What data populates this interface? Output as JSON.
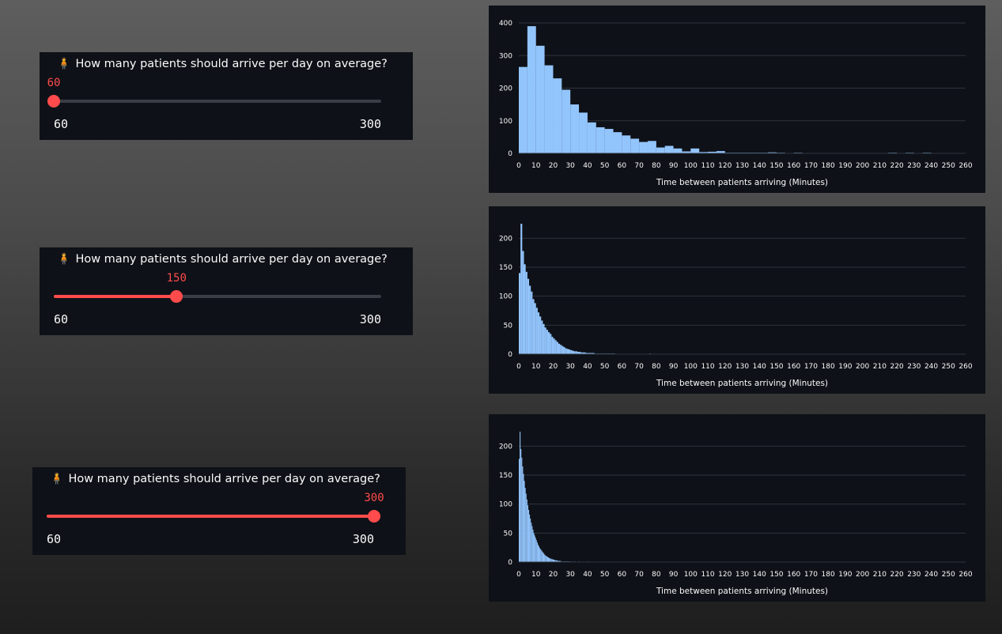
{
  "sliders": [
    {
      "label": "How many patients should arrive per day on average?",
      "icon": "person-standing-icon",
      "value": "60",
      "min": "60",
      "max": "300",
      "fraction": 0.0
    },
    {
      "label": "How many patients should arrive per day on average?",
      "icon": "person-standing-icon",
      "value": "150",
      "min": "60",
      "max": "300",
      "fraction": 0.375
    },
    {
      "label": "How many patients should arrive per day on average?",
      "icon": "person-standing-icon",
      "value": "300",
      "min": "60",
      "max": "300",
      "fraction": 1.0
    }
  ],
  "colors": {
    "accent": "#ff4b4b",
    "bar": "#93c5fd",
    "panel_bg": "#0e1117",
    "grid": "#2e323c",
    "text": "#fafafa"
  },
  "chart_data": [
    {
      "type": "bar",
      "title": "",
      "xlabel": "Time between patients arriving (Minutes)",
      "ylabel": "",
      "xlim": [
        0,
        260
      ],
      "ylim": [
        0,
        400
      ],
      "xticks": [
        0,
        10,
        20,
        30,
        40,
        50,
        60,
        70,
        80,
        90,
        100,
        110,
        120,
        130,
        140,
        150,
        160,
        170,
        180,
        190,
        200,
        210,
        220,
        230,
        240,
        250,
        260
      ],
      "yticks": [
        0,
        100,
        200,
        300,
        400
      ],
      "bin_width": 5,
      "values": [
        265,
        390,
        330,
        270,
        230,
        195,
        150,
        125,
        95,
        80,
        75,
        65,
        55,
        45,
        35,
        38,
        18,
        23,
        15,
        6,
        15,
        4,
        5,
        7,
        2,
        2,
        2,
        2,
        2,
        3,
        2,
        0,
        2,
        0,
        0,
        0,
        0,
        0,
        0,
        0,
        0,
        0,
        0,
        2,
        0,
        2,
        0,
        2,
        0,
        0,
        0,
        0,
        0
      ]
    },
    {
      "type": "bar",
      "title": "",
      "xlabel": "Time between patients arriving (Minutes)",
      "ylabel": "",
      "xlim": [
        0,
        260
      ],
      "ylim": [
        0,
        225
      ],
      "xticks": [
        0,
        10,
        20,
        30,
        40,
        50,
        60,
        70,
        80,
        90,
        100,
        110,
        120,
        130,
        140,
        150,
        160,
        170,
        180,
        190,
        200,
        210,
        220,
        230,
        240,
        250,
        260
      ],
      "yticks": [
        0,
        50,
        100,
        150,
        200
      ],
      "bin_width": 1,
      "values": [
        140,
        225,
        178,
        155,
        142,
        130,
        118,
        108,
        95,
        88,
        80,
        72,
        65,
        58,
        52,
        46,
        42,
        38,
        35,
        30,
        27,
        24,
        21,
        18,
        16,
        14,
        12,
        10,
        9,
        8,
        7,
        6,
        5,
        5,
        4,
        4,
        3,
        3,
        3,
        2,
        2,
        2,
        2,
        2,
        1,
        1,
        1,
        1,
        1,
        1,
        1,
        1,
        1,
        1,
        1,
        1,
        0,
        0,
        0,
        0,
        0,
        0,
        0,
        0,
        0,
        0,
        0,
        0,
        0,
        0,
        0,
        0,
        0,
        0,
        0,
        0,
        1,
        0,
        0,
        0,
        0,
        0,
        0,
        0,
        0,
        0,
        0,
        0,
        0,
        0,
        0,
        0,
        0,
        0,
        0,
        0,
        0,
        0,
        0,
        0,
        0,
        0,
        0,
        0,
        0,
        0,
        0,
        0,
        0,
        0,
        0,
        0,
        0,
        0,
        0,
        0,
        0,
        0,
        0,
        0,
        0,
        0,
        0,
        0,
        0,
        0,
        0,
        0,
        0,
        0,
        0,
        0,
        0,
        0,
        0,
        0,
        0,
        0,
        0,
        0,
        0,
        0,
        0,
        0,
        0,
        0,
        0,
        0,
        0,
        0,
        0,
        0,
        0,
        0,
        0,
        0,
        0,
        0,
        0,
        0,
        0,
        0,
        0,
        0,
        0,
        0,
        0,
        0,
        0,
        0,
        0,
        0,
        0,
        0,
        0,
        0,
        0,
        0,
        0,
        0,
        0,
        0,
        0,
        0,
        0,
        0,
        0,
        0,
        0,
        0,
        0,
        0,
        0,
        0,
        0,
        0,
        0,
        0,
        0,
        0,
        0,
        0,
        0,
        0,
        0,
        0,
        0,
        0,
        0,
        0,
        0,
        0,
        0,
        0,
        0,
        0,
        0,
        0,
        0,
        0,
        0,
        0,
        0,
        0,
        0,
        0,
        0,
        0,
        0,
        0,
        0,
        0,
        0,
        0,
        0,
        0,
        0,
        0,
        0,
        0,
        0,
        0,
        0,
        0,
        0,
        0,
        0,
        0,
        0,
        0,
        0,
        0,
        0,
        0,
        0
      ]
    },
    {
      "type": "bar",
      "title": "",
      "xlabel": "Time between patients arriving (Minutes)",
      "ylabel": "",
      "xlim": [
        0,
        260
      ],
      "ylim": [
        0,
        225
      ],
      "xticks": [
        0,
        10,
        20,
        30,
        40,
        50,
        60,
        70,
        80,
        90,
        100,
        110,
        120,
        130,
        140,
        150,
        160,
        170,
        180,
        190,
        200,
        210,
        220,
        230,
        240,
        250,
        260
      ],
      "yticks": [
        0,
        50,
        100,
        150,
        200
      ],
      "bin_width": 0.5,
      "values": [
        178,
        225,
        195,
        180,
        165,
        152,
        140,
        128,
        118,
        108,
        98,
        90,
        82,
        75,
        68,
        62,
        56,
        50,
        46,
        42,
        38,
        34,
        30,
        27,
        24,
        22,
        20,
        18,
        16,
        14,
        12,
        11,
        10,
        9,
        8,
        7,
        6,
        6,
        5,
        5,
        4,
        4,
        3,
        3,
        3,
        2,
        2,
        2,
        2,
        1,
        1,
        1,
        1,
        1,
        1,
        1,
        1,
        1,
        1,
        1,
        0,
        0,
        1,
        0,
        0,
        1,
        0,
        0,
        0,
        0,
        1,
        0,
        0,
        0,
        0,
        0,
        0,
        0,
        0,
        0,
        1,
        0,
        0,
        0,
        0,
        0,
        0,
        0,
        0,
        0,
        0,
        0,
        0,
        0,
        0,
        0,
        0,
        0,
        0,
        0,
        0,
        0,
        0,
        0,
        0,
        0,
        0,
        0,
        0,
        0,
        0,
        0,
        0,
        0,
        0,
        0,
        0,
        0,
        0,
        0,
        0,
        0,
        0,
        0,
        0,
        0,
        0,
        0,
        0,
        0
      ]
    }
  ]
}
